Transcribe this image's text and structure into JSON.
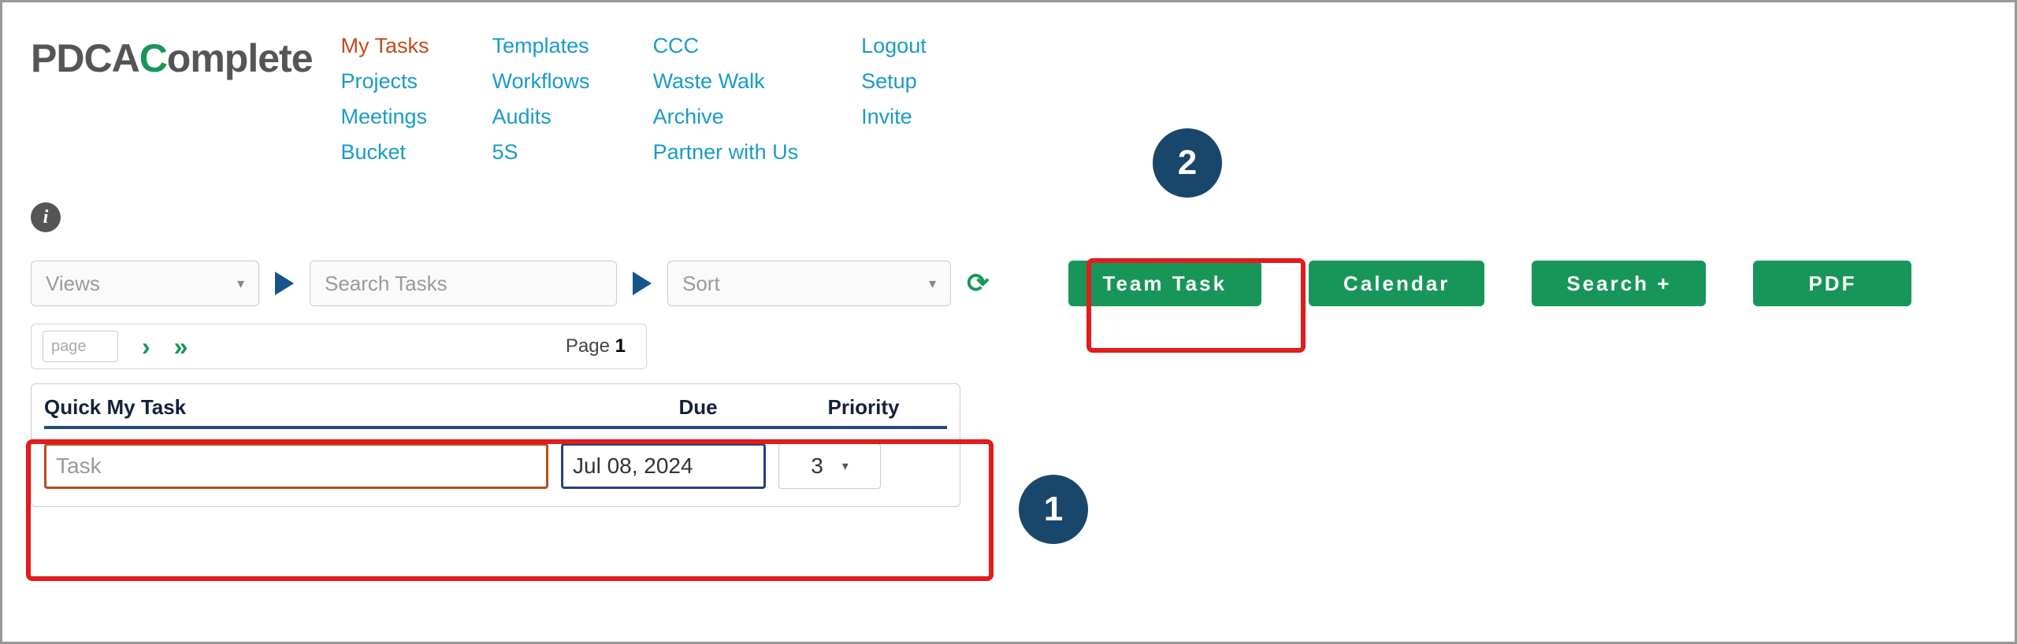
{
  "brand": {
    "prefix": "PDCA",
    "suffix": "Complete",
    "accent_letter": "C"
  },
  "nav": {
    "col1": [
      {
        "label": "My Tasks",
        "active": true
      },
      {
        "label": "Projects"
      },
      {
        "label": "Meetings"
      },
      {
        "label": "Bucket"
      }
    ],
    "col2": [
      {
        "label": "Templates"
      },
      {
        "label": "Workflows"
      },
      {
        "label": "Audits"
      },
      {
        "label": "5S"
      }
    ],
    "col3": [
      {
        "label": "CCC"
      },
      {
        "label": "Waste Walk"
      },
      {
        "label": "Archive"
      },
      {
        "label": "Partner with Us"
      }
    ],
    "col4": [
      {
        "label": "Logout"
      },
      {
        "label": "Setup"
      },
      {
        "label": "Invite"
      }
    ]
  },
  "toolbar": {
    "views_placeholder": "Views",
    "search_placeholder": "Search Tasks",
    "sort_placeholder": "Sort",
    "buttons": {
      "team_task": "Team Task",
      "calendar": "Calendar",
      "search_plus": "Search +",
      "pdf": "PDF"
    }
  },
  "pager": {
    "page_placeholder": "page",
    "page_label_prefix": "Page ",
    "page_number": "1"
  },
  "quick": {
    "header_task": "Quick My Task",
    "header_due": "Due",
    "header_priority": "Priority",
    "task_placeholder": "Task",
    "due_value": "Jul 08, 2024",
    "priority_value": "3"
  },
  "annotations": {
    "one": "1",
    "two": "2"
  }
}
